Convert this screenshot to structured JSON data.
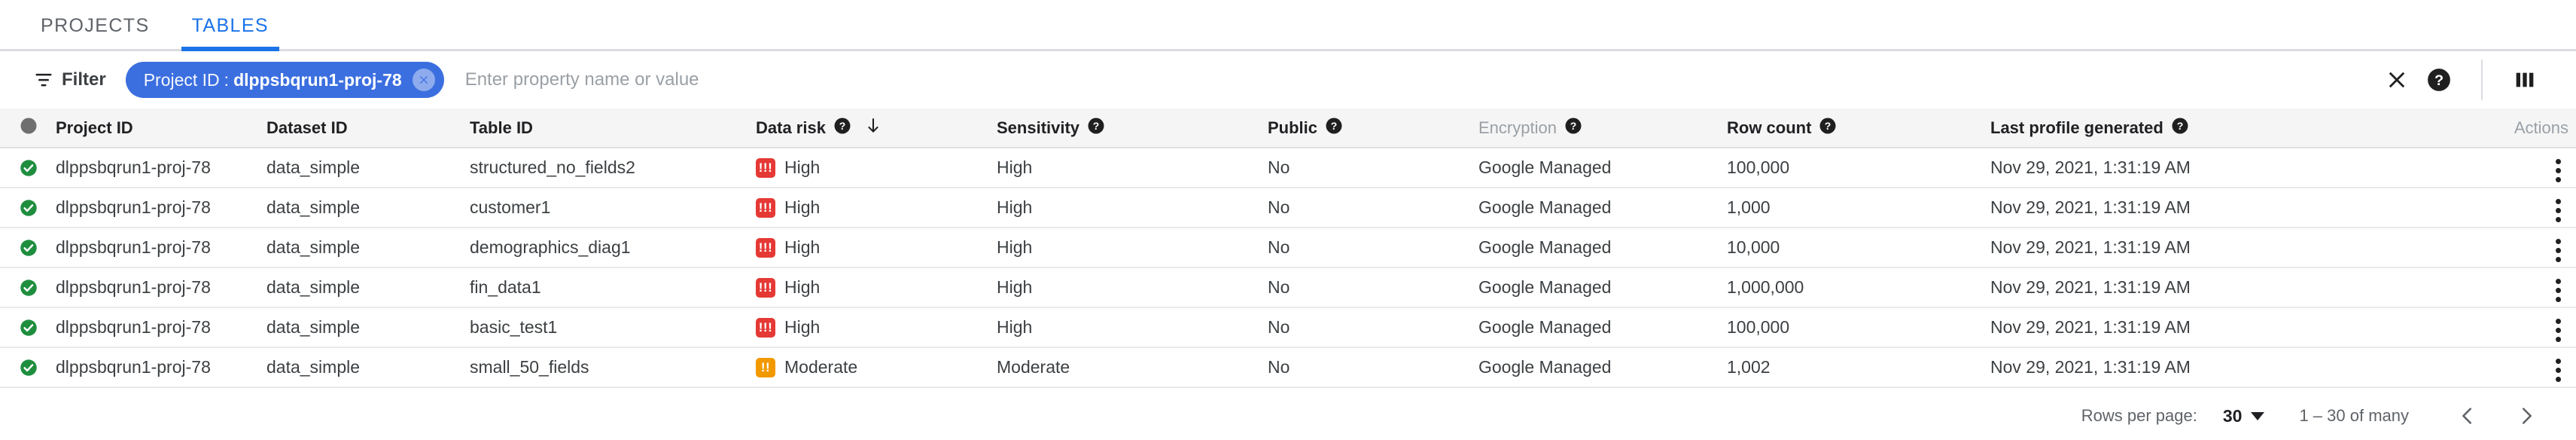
{
  "tabs": [
    {
      "label": "PROJECTS",
      "active": false
    },
    {
      "label": "TABLES",
      "active": true
    }
  ],
  "filter_bar": {
    "filter_label": "Filter",
    "chip": {
      "key": "Project ID",
      "separator": ":",
      "value": "dlppsbqrun1-proj-78",
      "remove_icon": "close-icon"
    },
    "input_placeholder": "Enter property name or value",
    "input_value": "",
    "clear_icon": "close-icon",
    "help_icon": "help-icon",
    "columns_icon": "column-settings-icon"
  },
  "colors": {
    "accent": "#1a73e8",
    "chip_bg": "#3b6fe0",
    "risk_high": "#e53935",
    "risk_moderate": "#f29900",
    "status_ok": "#1e8e3e",
    "header_bg": "#f5f5f5",
    "text_primary": "#3c4043",
    "text_muted": "#9aa0a6"
  },
  "table": {
    "columns": [
      {
        "key": "status",
        "label": "",
        "icon": "status-circle-icon",
        "help": false,
        "muted": false
      },
      {
        "key": "project_id",
        "label": "Project ID",
        "help": false,
        "muted": false
      },
      {
        "key": "dataset_id",
        "label": "Dataset ID",
        "help": false,
        "muted": false
      },
      {
        "key": "table_id",
        "label": "Table ID",
        "help": false,
        "muted": false
      },
      {
        "key": "data_risk",
        "label": "Data risk",
        "help": true,
        "muted": false,
        "sorted": "desc"
      },
      {
        "key": "sensitivity",
        "label": "Sensitivity",
        "help": true,
        "muted": false
      },
      {
        "key": "public",
        "label": "Public",
        "help": true,
        "muted": false
      },
      {
        "key": "encryption",
        "label": "Encryption",
        "help": true,
        "muted": true
      },
      {
        "key": "row_count",
        "label": "Row count",
        "help": true,
        "muted": false
      },
      {
        "key": "last_profile_generated",
        "label": "Last profile generated",
        "help": true,
        "muted": false
      },
      {
        "key": "actions",
        "label": "Actions",
        "help": false,
        "muted": true
      }
    ],
    "rows": [
      {
        "status": "ok",
        "project_id": "dlppsbqrun1-proj-78",
        "dataset_id": "data_simple",
        "table_id": "structured_no_fields2",
        "data_risk": "High",
        "data_risk_level": "high",
        "data_risk_glyph": "!!!",
        "sensitivity": "High",
        "public": "No",
        "encryption": "Google Managed",
        "row_count": "100,000",
        "last_profile_generated": "Nov 29, 2021, 1:31:19 AM"
      },
      {
        "status": "ok",
        "project_id": "dlppsbqrun1-proj-78",
        "dataset_id": "data_simple",
        "table_id": "customer1",
        "data_risk": "High",
        "data_risk_level": "high",
        "data_risk_glyph": "!!!",
        "sensitivity": "High",
        "public": "No",
        "encryption": "Google Managed",
        "row_count": "1,000",
        "last_profile_generated": "Nov 29, 2021, 1:31:19 AM"
      },
      {
        "status": "ok",
        "project_id": "dlppsbqrun1-proj-78",
        "dataset_id": "data_simple",
        "table_id": "demographics_diag1",
        "data_risk": "High",
        "data_risk_level": "high",
        "data_risk_glyph": "!!!",
        "sensitivity": "High",
        "public": "No",
        "encryption": "Google Managed",
        "row_count": "10,000",
        "last_profile_generated": "Nov 29, 2021, 1:31:19 AM"
      },
      {
        "status": "ok",
        "project_id": "dlppsbqrun1-proj-78",
        "dataset_id": "data_simple",
        "table_id": "fin_data1",
        "data_risk": "High",
        "data_risk_level": "high",
        "data_risk_glyph": "!!!",
        "sensitivity": "High",
        "public": "No",
        "encryption": "Google Managed",
        "row_count": "1,000,000",
        "last_profile_generated": "Nov 29, 2021, 1:31:19 AM"
      },
      {
        "status": "ok",
        "project_id": "dlppsbqrun1-proj-78",
        "dataset_id": "data_simple",
        "table_id": "basic_test1",
        "data_risk": "High",
        "data_risk_level": "high",
        "data_risk_glyph": "!!!",
        "sensitivity": "High",
        "public": "No",
        "encryption": "Google Managed",
        "row_count": "100,000",
        "last_profile_generated": "Nov 29, 2021, 1:31:19 AM"
      },
      {
        "status": "ok",
        "project_id": "dlppsbqrun1-proj-78",
        "dataset_id": "data_simple",
        "table_id": "small_50_fields",
        "data_risk": "Moderate",
        "data_risk_level": "moderate",
        "data_risk_glyph": "!!",
        "sensitivity": "Moderate",
        "public": "No",
        "encryption": "Google Managed",
        "row_count": "1,002",
        "last_profile_generated": "Nov 29, 2021, 1:31:19 AM"
      }
    ]
  },
  "footer": {
    "rows_per_page_label": "Rows per page:",
    "rows_per_page_value": "30",
    "range_label": "1 – 30 of many",
    "prev_icon": "chevron-left-icon",
    "next_icon": "chevron-right-icon"
  }
}
